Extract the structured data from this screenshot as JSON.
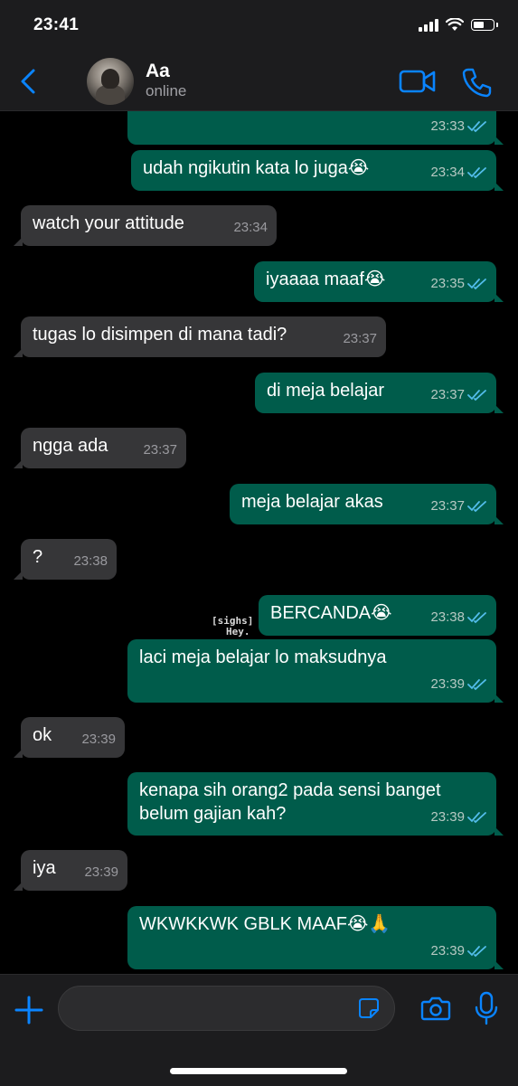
{
  "status_bar": {
    "time": "23:41",
    "battery_level": 0.62
  },
  "header": {
    "contact_name": "Aa",
    "contact_status": "online"
  },
  "colors": {
    "accent": "#0a84ff",
    "outgoing_bubble": "#005c4b",
    "incoming_bubble": "#363638",
    "read_ticks": "#53bdeb"
  },
  "icons": {
    "back": "chevron-left-icon",
    "video": "video-camera-icon",
    "call": "phone-icon",
    "attach": "plus-icon",
    "sticker": "sticker-icon",
    "camera": "camera-icon",
    "mic": "microphone-icon"
  },
  "messages": [
    {
      "dir": "out",
      "text": "",
      "time": "23:33",
      "read": true
    },
    {
      "dir": "out",
      "text": "udah ngikutin kata lo juga😭",
      "time": "23:34",
      "read": true
    },
    {
      "dir": "in",
      "text": "watch your attitude",
      "time": "23:34"
    },
    {
      "dir": "out",
      "text": "iyaaaa maaf😭",
      "time": "23:35",
      "read": true
    },
    {
      "dir": "in",
      "text": "tugas lo disimpen di mana tadi?",
      "time": "23:37"
    },
    {
      "dir": "out",
      "text": "di meja belajar",
      "time": "23:37",
      "read": true
    },
    {
      "dir": "in",
      "text": "ngga ada",
      "time": "23:37"
    },
    {
      "dir": "out",
      "text": "meja belajar akas",
      "time": "23:37",
      "read": true
    },
    {
      "dir": "in",
      "text": "?",
      "time": "23:38"
    },
    {
      "dir": "out",
      "text": "BERCANDA😭",
      "time": "23:38",
      "read": true
    },
    {
      "dir": "out",
      "text": "laci meja belajar lo maksudnya",
      "time": "23:39",
      "read": true
    },
    {
      "dir": "in",
      "text": "ok",
      "time": "23:39"
    },
    {
      "dir": "out",
      "text": "kenapa sih orang2 pada sensi banget",
      "text2": "belum gajian kah?",
      "time": "23:39",
      "read": true
    },
    {
      "dir": "in",
      "text": "iya",
      "time": "23:39"
    },
    {
      "dir": "out",
      "text": "WKWKKWK GBLK MAAF😭🙏",
      "time": "23:39",
      "read": true
    }
  ],
  "sticker_text": {
    "line1": "[sighs]",
    "line2": "Hey."
  }
}
